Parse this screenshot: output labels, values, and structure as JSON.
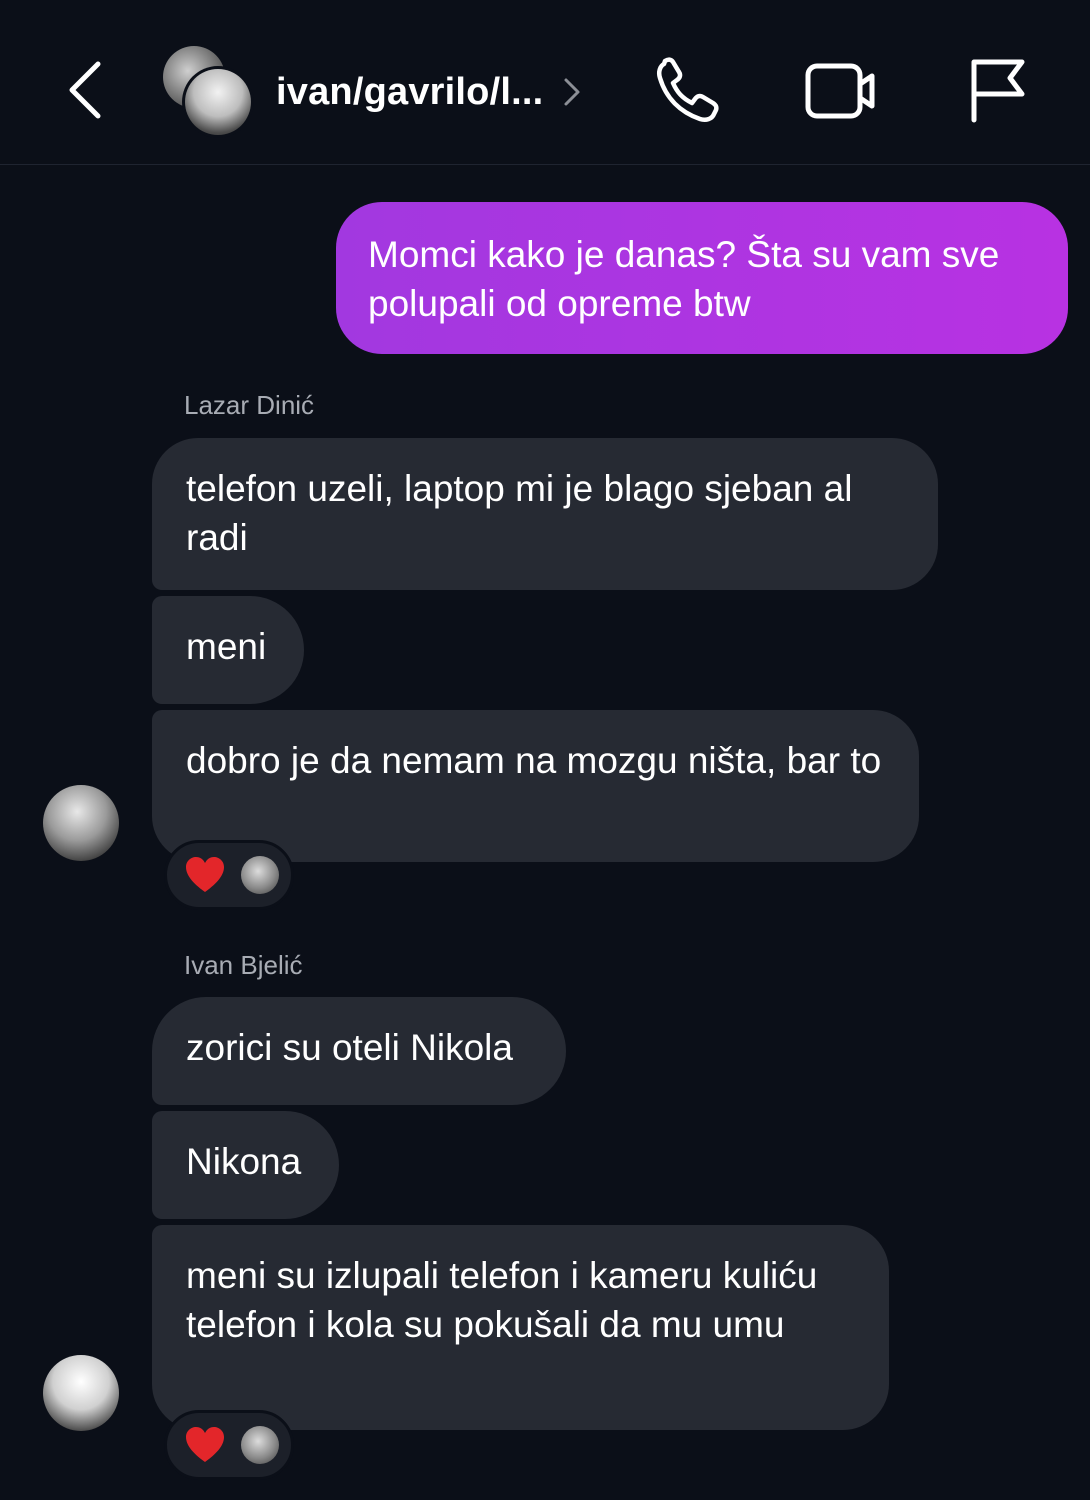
{
  "header": {
    "title": "ivan/gavrilo/l...",
    "icons": {
      "back": "chevron-left-icon",
      "open": "chevron-right-icon",
      "call": "phone-icon",
      "video": "video-camera-icon",
      "report": "flag-icon"
    }
  },
  "colors": {
    "background": "#0b0f18",
    "outgoing_bubble": "#b032e0",
    "incoming_bubble": "#262a33",
    "sender_name": "#a8acb4",
    "reaction_heart": "#e3262a"
  },
  "messages": {
    "outgoing_1": "Momci kako je danas? Šta su vam sve polupali od opreme btw",
    "sender_1": "Lazar Dinić",
    "lazar_1": "telefon uzeli, laptop mi je blago sjeban al radi",
    "lazar_2": "meni",
    "lazar_3": "dobro je da nemam na mozgu ništa, bar to",
    "sender_2": "Ivan Bjelić",
    "ivan_1": "zorici su oteli Nikola",
    "ivan_2": "Nikona",
    "ivan_3": "meni su izlupali telefon i kameru kuliću telefon i kola su pokušali da mu umu"
  },
  "reactions": {
    "lazar_3": [
      "heart-emoji",
      "reactor-avatar"
    ],
    "ivan_3": [
      "heart-emoji",
      "reactor-avatar"
    ]
  }
}
